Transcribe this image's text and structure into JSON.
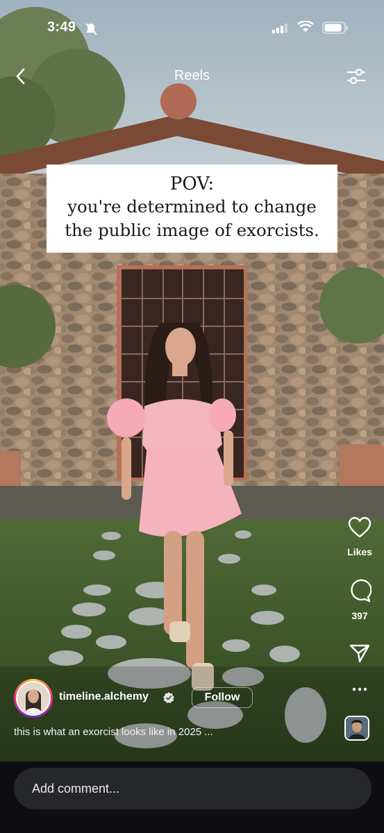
{
  "status": {
    "time": "3:49"
  },
  "header": {
    "title": "Reels"
  },
  "overlay": {
    "line1": "POV:",
    "line2": "you're determined to change",
    "line3": "the public image of exorcists."
  },
  "actions": {
    "likes_label": "Likes",
    "comments_count": "397"
  },
  "author": {
    "username": "timeline.alchemy",
    "follow_label": "Follow"
  },
  "post": {
    "description": "this is what an exorcist looks like in 2025 ..."
  },
  "comment": {
    "placeholder": "Add comment..."
  }
}
